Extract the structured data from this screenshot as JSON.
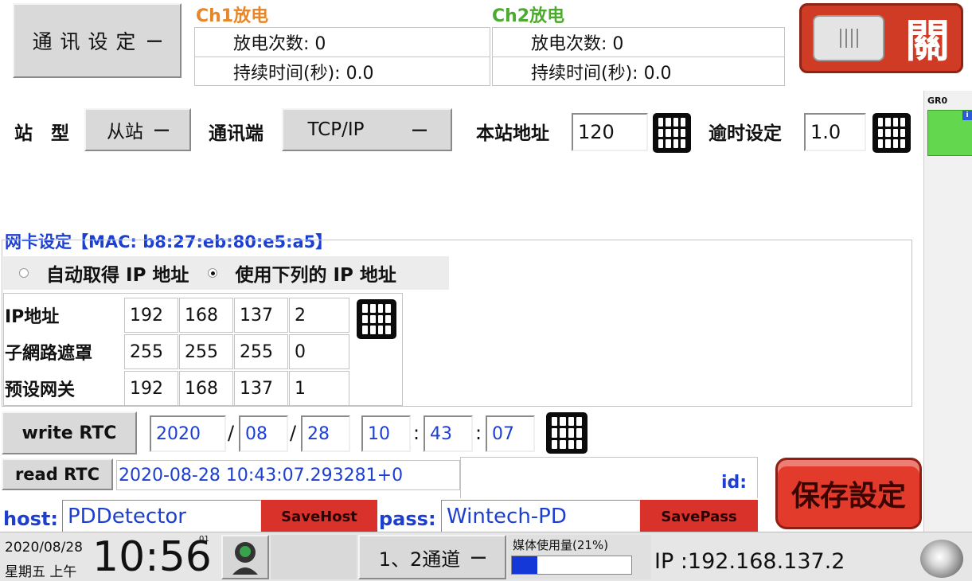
{
  "comm_button": "通 讯 设 定",
  "ch1": {
    "title": "Ch1放电",
    "count_label": "放电次数: 0",
    "duration_label": "持续时间(秒): 0.0"
  },
  "ch2": {
    "title": "Ch2放电",
    "count_label": "放电次数: 0",
    "duration_label": "持续时间(秒): 0.0"
  },
  "close_button": "關",
  "gr_label": "GR0",
  "gr_badge": "i",
  "station": {
    "type_label": "站　型",
    "type_value": "从站",
    "port_label": "通讯端",
    "port_value": "TCP/IP",
    "address_label": "本站地址",
    "address_value": "120",
    "timeout_label": "逾时设定",
    "timeout_value": "1.0"
  },
  "nic": {
    "title": "网卡设定【MAC: b8:27:eb:80:e5:a5】",
    "auto_label": "自动取得 IP 地址",
    "manual_label": "使用下列的 IP 地址",
    "rows": [
      {
        "label": "IP地址",
        "values": [
          "192",
          "168",
          "137",
          "2"
        ]
      },
      {
        "label": "子網路遮罩",
        "values": [
          "255",
          "255",
          "255",
          "0"
        ]
      },
      {
        "label": "预设网关",
        "values": [
          "192",
          "168",
          "137",
          "1"
        ]
      }
    ]
  },
  "rtc": {
    "write_label": "write RTC",
    "year": "2020",
    "month": "08",
    "day": "28",
    "hour": "10",
    "minute": "43",
    "second": "07",
    "sep_date": "/",
    "sep_time": ":",
    "read_label": "read RTC",
    "read_value": "2020-08-28 10:43:07.293281+0"
  },
  "id_label": "id:",
  "save_settings": "保存設定",
  "host": {
    "label": "host:",
    "value": "PDDetector",
    "save": "SaveHost"
  },
  "pass": {
    "label": "pass:",
    "value": "Wintech-PD",
    "save": "SavePass"
  },
  "status": {
    "date": "2020/08/28",
    "weekday": "星期五 上午",
    "time": "10:56",
    "seconds": "01",
    "channel": "1、2通道",
    "media_label": "媒体使用量(21%)",
    "media_usage": 0.21,
    "ip": "IP :192.168.137.2"
  },
  "colors": {
    "ch1": "#e8862a",
    "ch2": "#4caa2e",
    "blue": "#1d3fd0",
    "red": "#d8322a",
    "green": "#63d84e"
  }
}
